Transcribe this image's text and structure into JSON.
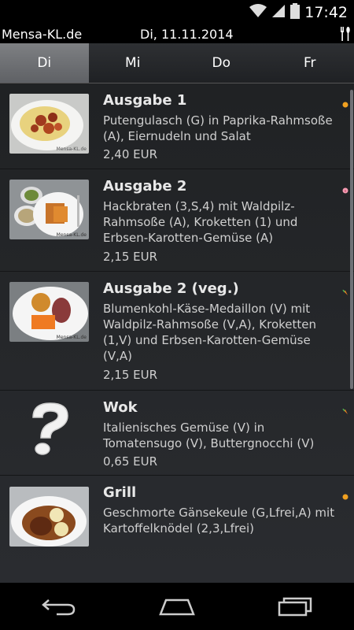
{
  "status_bar": {
    "time": "17:42"
  },
  "app": {
    "title": "Mensa-KL.de",
    "date": "Di, 11.11.2014"
  },
  "tabs": [
    {
      "label": "Di",
      "active": true
    },
    {
      "label": "Mi",
      "active": false
    },
    {
      "label": "Do",
      "active": false
    },
    {
      "label": "Fr",
      "active": false
    }
  ],
  "meals": [
    {
      "title": "Ausgabe 1",
      "description": "Putengulasch (G) in Paprika-Rahmsoße (A), Eiernudeln und Salat",
      "price": "2,40 EUR",
      "badge_icon": "orange-dot-icon",
      "photo_caption": "Mensa-KL.de"
    },
    {
      "title": "Ausgabe 2",
      "description": "Hackbraten (3,S,4) mit Waldpilz-Rahmsoße (A), Kroketten (1) und Erbsen-Karotten-Gemüse (A)",
      "price": "2,15 EUR",
      "badge_icon": "pig-icon",
      "photo_caption": "Mensa-KL.de"
    },
    {
      "title": "Ausgabe 2 (veg.)",
      "description": "Blumenkohl-Käse-Medaillon (V) mit Waldpilz-Rahmsoße (V,A), Kroketten (1,V) und Erbsen-Karotten-Gemüse (V,A)",
      "price": "2,15 EUR",
      "badge_icon": "carrot-icon",
      "photo_caption": "Mensa-KL.de"
    },
    {
      "title": "Wok",
      "description": "Italienisches Gemüse (V) in Tomatensugo (V), Buttergnocchi (V)",
      "price": "0,65 EUR",
      "badge_icon": "carrot-icon",
      "photo_caption": ""
    },
    {
      "title": "Grill",
      "description": "Geschmorte Gänsekeule (G,Lfrei,A) mit Kartoffelknödel (2,3,Lfrei)",
      "price": "",
      "badge_icon": "orange-dot-icon",
      "photo_caption": ""
    }
  ],
  "colors": {
    "background": "#222427",
    "tab_active": "#6e7074",
    "text": "#cfcfcf"
  }
}
